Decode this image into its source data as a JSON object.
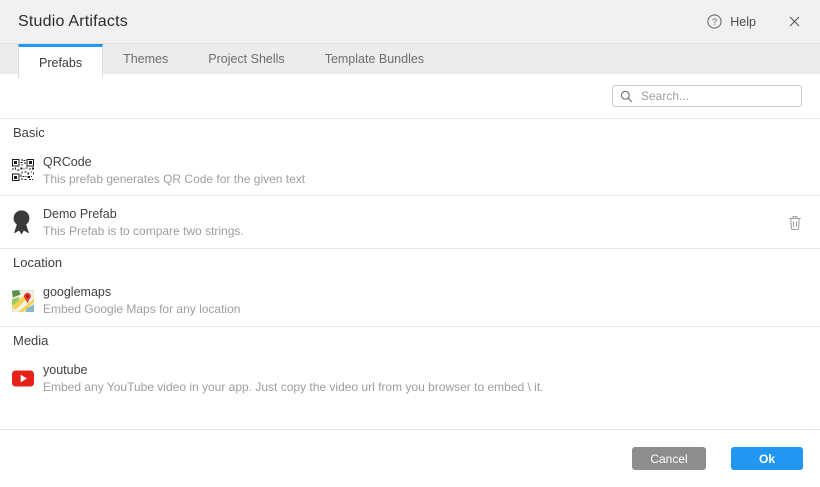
{
  "dialog": {
    "title": "Studio Artifacts",
    "help_label": "Help"
  },
  "tabs": [
    {
      "label": "Prefabs",
      "active": true
    },
    {
      "label": "Themes",
      "active": false
    },
    {
      "label": "Project Shells",
      "active": false
    },
    {
      "label": "Template Bundles",
      "active": false
    }
  ],
  "search": {
    "placeholder": "Search...",
    "value": ""
  },
  "sections": [
    {
      "name": "Basic",
      "items": [
        {
          "icon": "qrcode-icon",
          "title": "QRCode",
          "description": "This prefab generates QR Code for the given text",
          "deletable": false
        },
        {
          "icon": "ribbon-icon",
          "title": "Demo Prefab",
          "description": "This Prefab is to compare two strings.",
          "deletable": true
        }
      ]
    },
    {
      "name": "Location",
      "items": [
        {
          "icon": "googlemaps-icon",
          "title": "googlemaps",
          "description": "Embed Google Maps for any location",
          "deletable": false
        }
      ]
    },
    {
      "name": "Media",
      "items": [
        {
          "icon": "youtube-icon",
          "title": "youtube",
          "description": "Embed any YouTube video in your app. Just copy the video url from you browser to embed \\ it.",
          "deletable": false
        }
      ]
    }
  ],
  "footer": {
    "cancel_label": "Cancel",
    "ok_label": "Ok"
  },
  "colors": {
    "accent": "#2196f3",
    "cancel_button": "#8d8d8d",
    "youtube_red": "#e62117",
    "header_bg": "#f1f1f1",
    "tabbar_bg": "#ececec"
  }
}
